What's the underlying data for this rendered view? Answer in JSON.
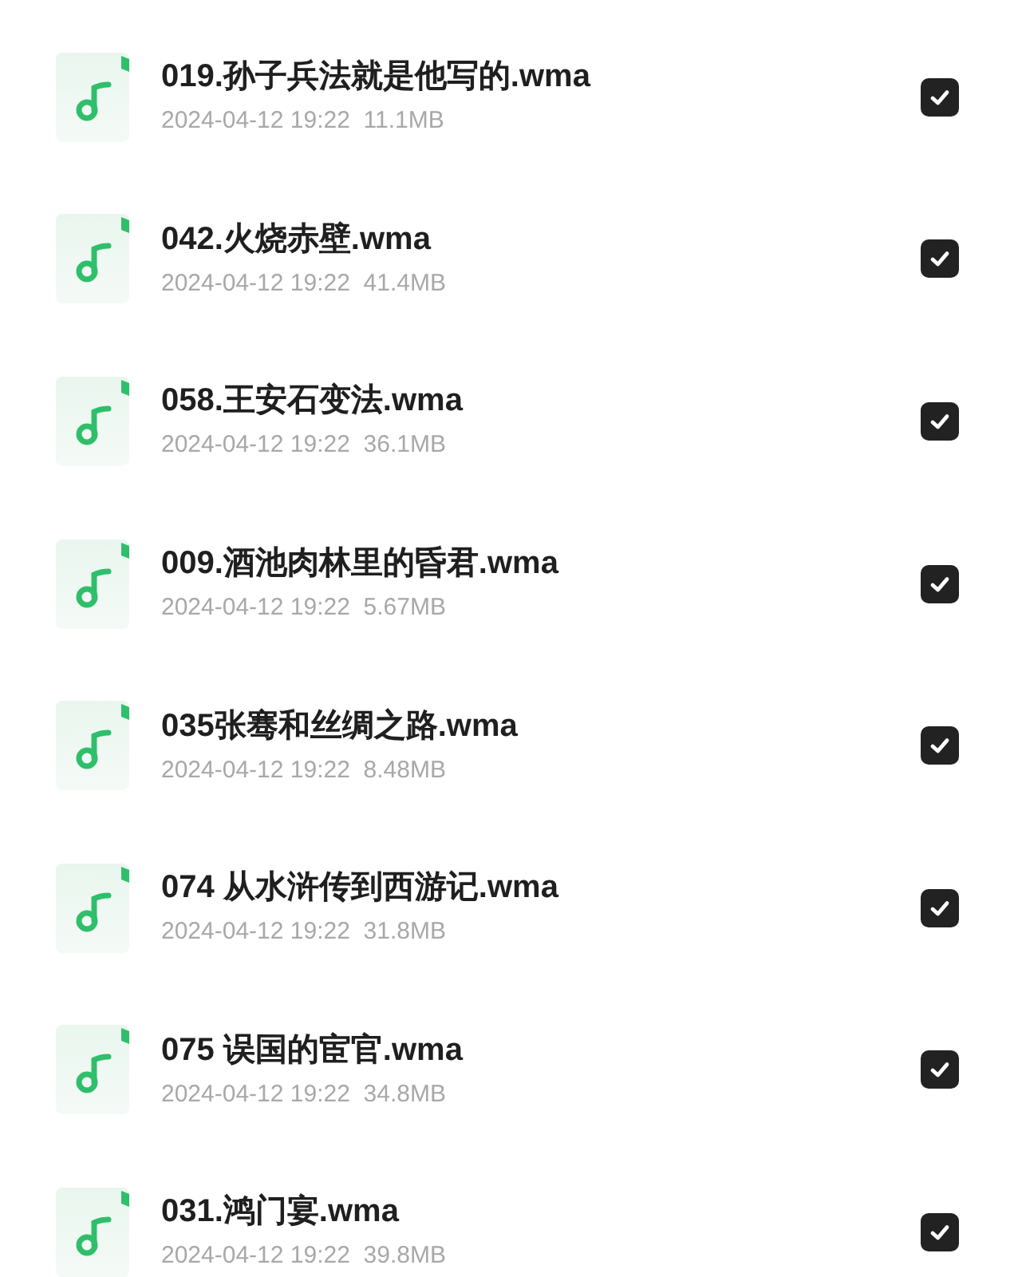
{
  "files": [
    {
      "name": "019.孙子兵法就是他写的.wma",
      "date": "2024-04-12 19:22",
      "size": "11.1MB",
      "checked": true
    },
    {
      "name": "042.火烧赤壁.wma",
      "date": "2024-04-12 19:22",
      "size": "41.4MB",
      "checked": true
    },
    {
      "name": "058.王安石变法.wma",
      "date": "2024-04-12 19:22",
      "size": "36.1MB",
      "checked": true
    },
    {
      "name": "009.酒池肉林里的昏君.wma",
      "date": "2024-04-12 19:22",
      "size": "5.67MB",
      "checked": true
    },
    {
      "name": "035张骞和丝绸之路.wma",
      "date": "2024-04-12 19:22",
      "size": "8.48MB",
      "checked": true
    },
    {
      "name": "074 从水浒传到西游记.wma",
      "date": "2024-04-12 19:22",
      "size": "31.8MB",
      "checked": true
    },
    {
      "name": "075 误国的宦官.wma",
      "date": "2024-04-12 19:22",
      "size": "34.8MB",
      "checked": true
    },
    {
      "name": "031.鸿门宴.wma",
      "date": "2024-04-12 19:22",
      "size": "39.8MB",
      "checked": true
    }
  ]
}
